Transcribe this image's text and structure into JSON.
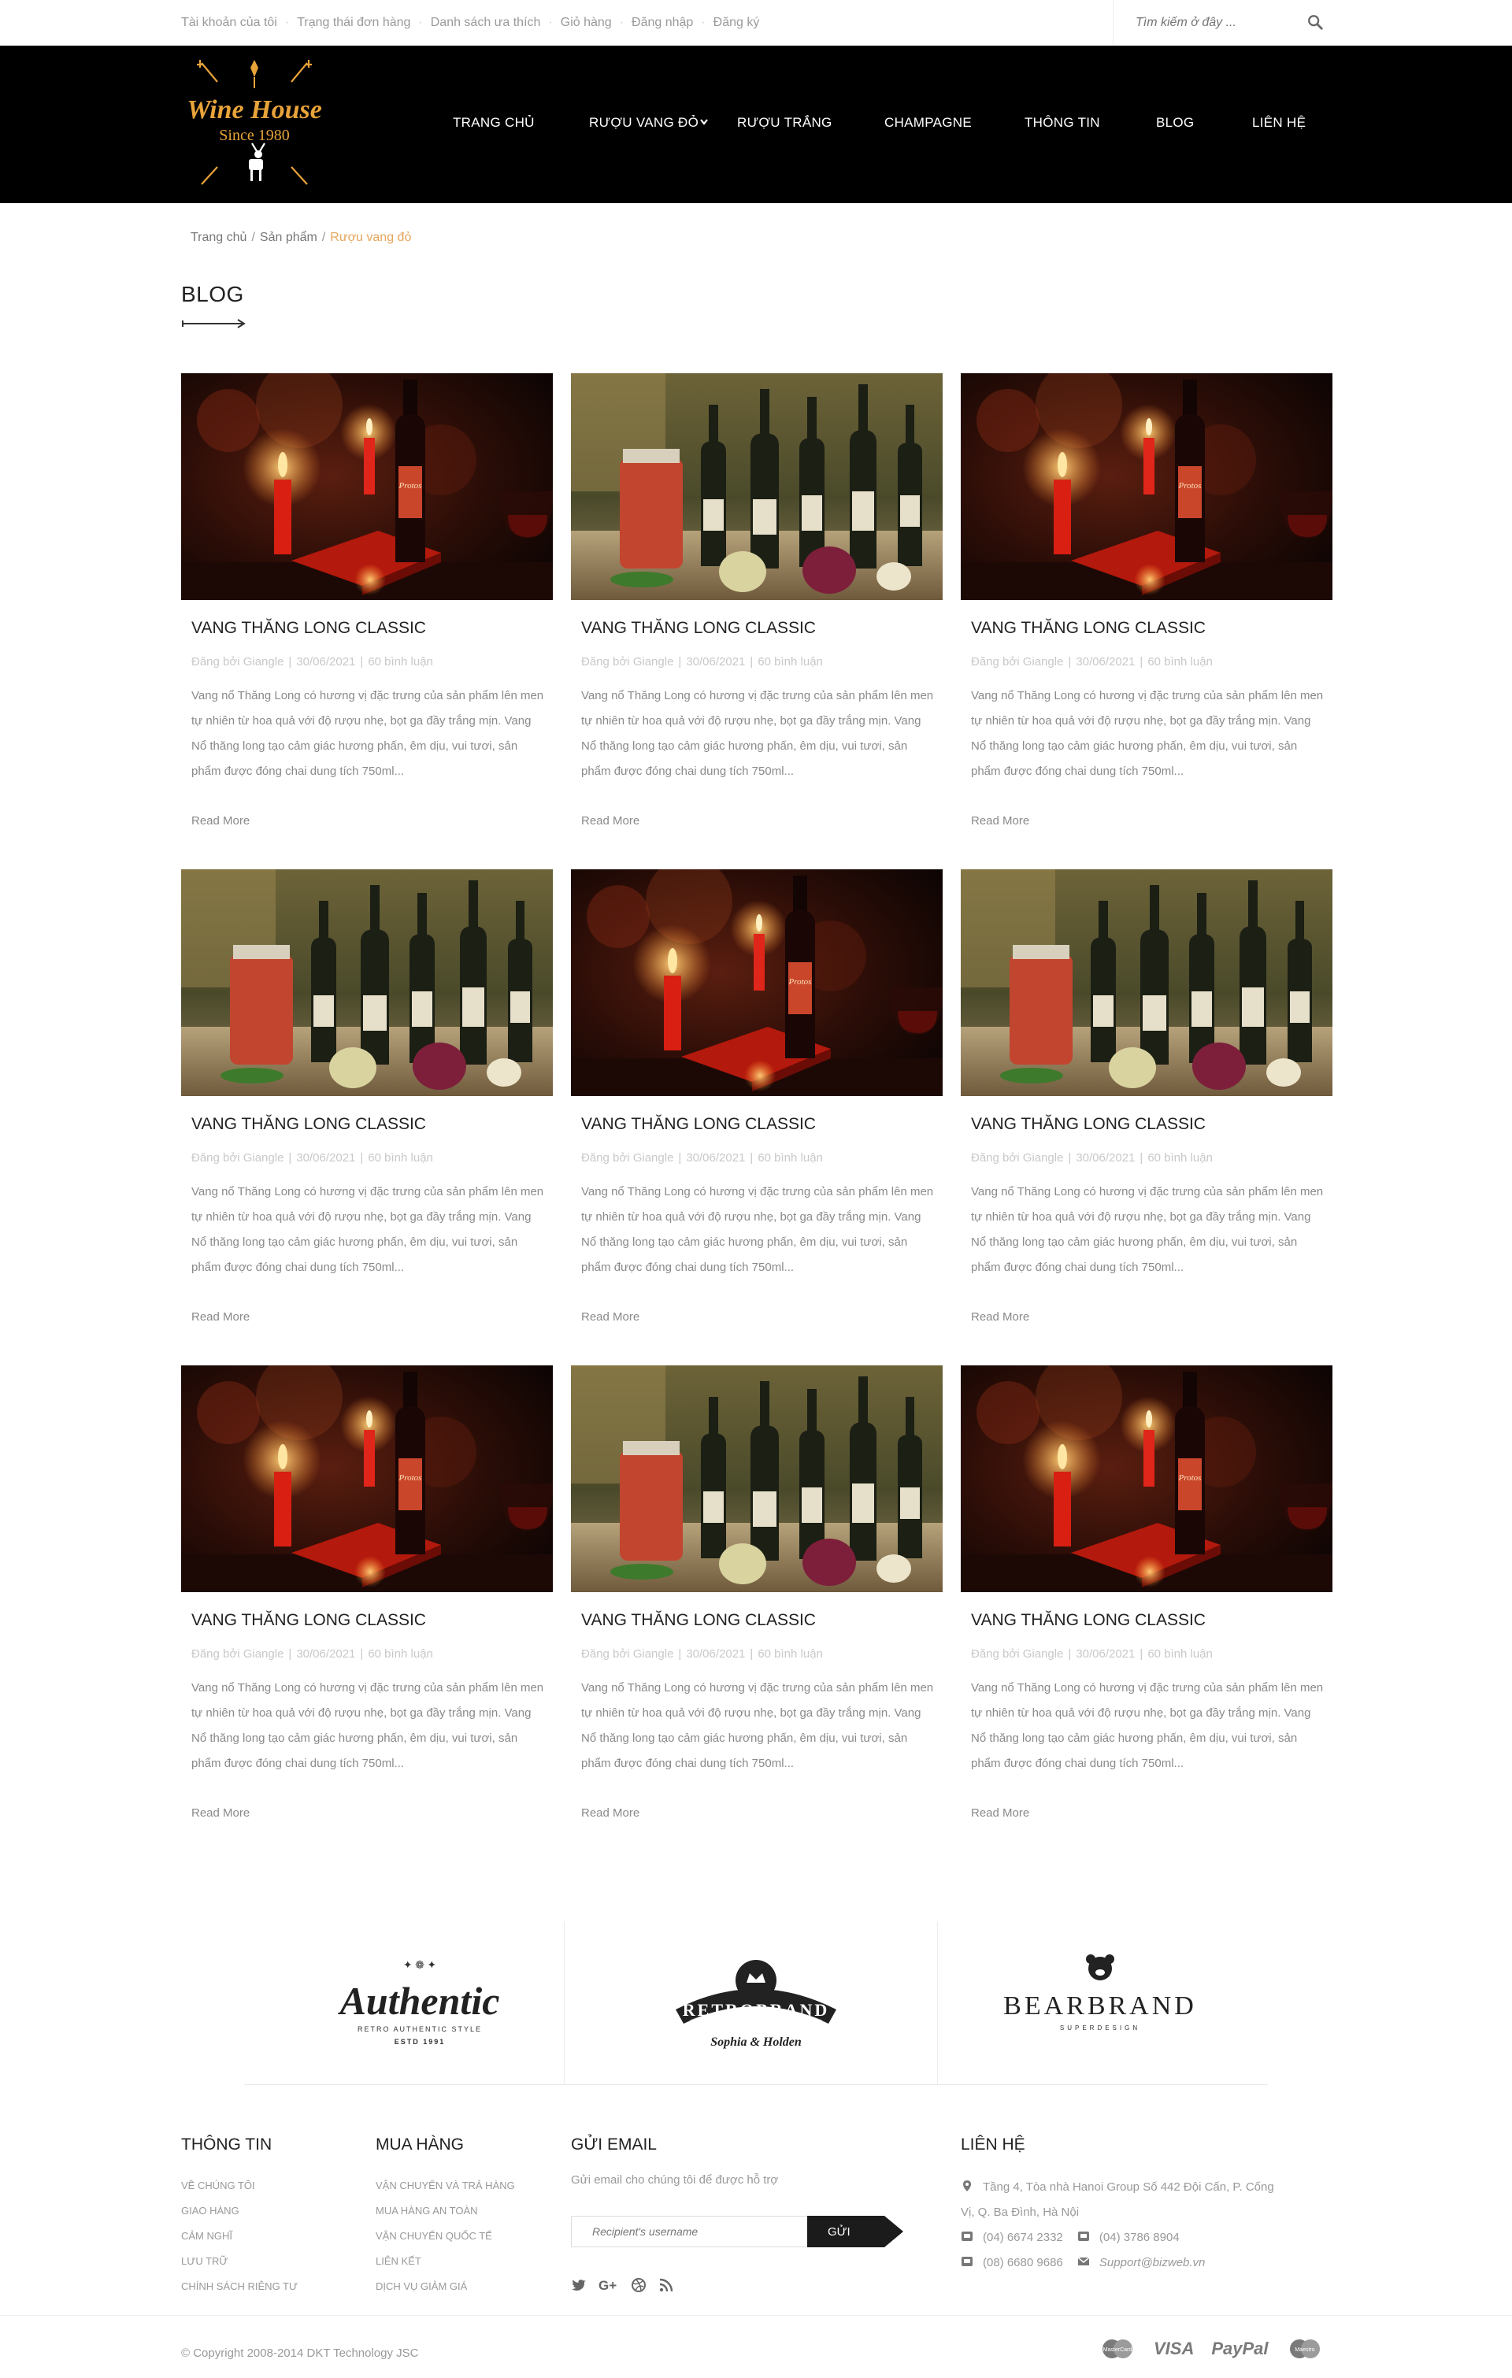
{
  "topbar": {
    "links": [
      "Tài khoản của tôi",
      "Trạng thái đơn hàng",
      "Danh sách ưa thích",
      "Giỏ hàng",
      "Đăng nhập",
      "Đăng ký"
    ],
    "search_placeholder": "Tìm kiếm ở đây ..."
  },
  "logo": {
    "name": "Wine House",
    "tagline": "Since 1980"
  },
  "nav": {
    "items": [
      "TRANG CHỦ",
      "RƯỢU VANG ĐỎ",
      "RƯỢU TRẮNG",
      "CHAMPAGNE",
      "THÔNG TIN",
      "BLOG",
      "LIÊN HỆ"
    ]
  },
  "breadcrumb": {
    "home": "Trang chủ",
    "products": "Sản phẩm",
    "current": "Rượu vang đỏ"
  },
  "page_title": "BLOG",
  "posts": [
    {
      "title": "VANG THĂNG LONG CLASSIC",
      "author": "Đăng bởi Giangle",
      "date": "30/06/2021",
      "comments": "60 bình luận",
      "excerpt": "Vang nổ Thăng Long có hương vị đặc trưng của sản phẩm lên men tự nhiên từ hoa quả với độ rượu nhẹ, bọt ga đầy trắng mịn. Vang Nổ thăng long tạo cảm giác hương phấn, êm dịu, vui tươi, sản phẩm được đóng chai dung tích 750ml...",
      "read_more": "Read More",
      "image": "candle"
    },
    {
      "title": "VANG THĂNG LONG CLASSIC",
      "author": "Đăng bởi Giangle",
      "date": "30/06/2021",
      "comments": "60 bình luận",
      "excerpt": "Vang nổ Thăng Long có hương vị đặc trưng của sản phẩm lên men tự nhiên từ hoa quả với độ rượu nhẹ, bọt ga đầy trắng mịn. Vang Nổ thăng long tạo cảm giác hương phấn, êm dịu, vui tươi, sản phẩm được đóng chai dung tích 750ml...",
      "read_more": "Read More",
      "image": "bottles"
    },
    {
      "title": "VANG THĂNG LONG CLASSIC",
      "author": "Đăng bởi Giangle",
      "date": "30/06/2021",
      "comments": "60 bình luận",
      "excerpt": "Vang nổ Thăng Long có hương vị đặc trưng của sản phẩm lên men tự nhiên từ hoa quả với độ rượu nhẹ, bọt ga đầy trắng mịn. Vang Nổ thăng long tạo cảm giác hương phấn, êm dịu, vui tươi, sản phẩm được đóng chai dung tích 750ml...",
      "read_more": "Read More",
      "image": "candle"
    },
    {
      "title": "VANG THĂNG LONG CLASSIC",
      "author": "Đăng bởi Giangle",
      "date": "30/06/2021",
      "comments": "60 bình luận",
      "excerpt": "Vang nổ Thăng Long có hương vị đặc trưng của sản phẩm lên men tự nhiên từ hoa quả với độ rượu nhẹ, bọt ga đầy trắng mịn. Vang Nổ thăng long tạo cảm giác hương phấn, êm dịu, vui tươi, sản phẩm được đóng chai dung tích 750ml...",
      "read_more": "Read More",
      "image": "bottles"
    },
    {
      "title": "VANG THĂNG LONG CLASSIC",
      "author": "Đăng bởi Giangle",
      "date": "30/06/2021",
      "comments": "60 bình luận",
      "excerpt": "Vang nổ Thăng Long có hương vị đặc trưng của sản phẩm lên men tự nhiên từ hoa quả với độ rượu nhẹ, bọt ga đầy trắng mịn. Vang Nổ thăng long tạo cảm giác hương phấn, êm dịu, vui tươi, sản phẩm được đóng chai dung tích 750ml...",
      "read_more": "Read More",
      "image": "candle"
    },
    {
      "title": "VANG THĂNG LONG CLASSIC",
      "author": "Đăng bởi Giangle",
      "date": "30/06/2021",
      "comments": "60 bình luận",
      "excerpt": "Vang nổ Thăng Long có hương vị đặc trưng của sản phẩm lên men tự nhiên từ hoa quả với độ rượu nhẹ, bọt ga đầy trắng mịn. Vang Nổ thăng long tạo cảm giác hương phấn, êm dịu, vui tươi, sản phẩm được đóng chai dung tích 750ml...",
      "read_more": "Read More",
      "image": "bottles"
    },
    {
      "title": "VANG THĂNG LONG CLASSIC",
      "author": "Đăng bởi Giangle",
      "date": "30/06/2021",
      "comments": "60 bình luận",
      "excerpt": "Vang nổ Thăng Long có hương vị đặc trưng của sản phẩm lên men tự nhiên từ hoa quả với độ rượu nhẹ, bọt ga đầy trắng mịn. Vang Nổ thăng long tạo cảm giác hương phấn, êm dịu, vui tươi, sản phẩm được đóng chai dung tích 750ml...",
      "read_more": "Read More",
      "image": "candle"
    },
    {
      "title": "VANG THĂNG LONG CLASSIC",
      "author": "Đăng bởi Giangle",
      "date": "30/06/2021",
      "comments": "60 bình luận",
      "excerpt": "Vang nổ Thăng Long có hương vị đặc trưng của sản phẩm lên men tự nhiên từ hoa quả với độ rượu nhẹ, bọt ga đầy trắng mịn. Vang Nổ thăng long tạo cảm giác hương phấn, êm dịu, vui tươi, sản phẩm được đóng chai dung tích 750ml...",
      "read_more": "Read More",
      "image": "bottles"
    },
    {
      "title": "VANG THĂNG LONG CLASSIC",
      "author": "Đăng bởi Giangle",
      "date": "30/06/2021",
      "comments": "60 bình luận",
      "excerpt": "Vang nổ Thăng Long có hương vị đặc trưng của sản phẩm lên men tự nhiên từ hoa quả với độ rượu nhẹ, bọt ga đầy trắng mịn. Vang Nổ thăng long tạo cảm giác hương phấn, êm dịu, vui tươi, sản phẩm được đóng chai dung tích 750ml...",
      "read_more": "Read More",
      "image": "candle"
    }
  ],
  "brands": [
    {
      "name": "Authentic",
      "subtitle": "RETRO AUTHENTIC STYLE",
      "extra": "ESTD 1991"
    },
    {
      "name": "RETROBRAND",
      "subtitle": "Sophia & Holden",
      "extra": ""
    },
    {
      "name": "BEARBRAND",
      "subtitle": "SUPERDESIGN",
      "extra": ""
    }
  ],
  "footer": {
    "info": {
      "heading": "THÔNG TIN",
      "links": [
        "VỀ CHÚNG TÔI",
        "GIAO HÀNG",
        "CẢM NGHĨ",
        "LƯU TRỮ",
        "CHÍNH SÁCH RIÊNG TƯ"
      ]
    },
    "shop": {
      "heading": "MUA HÀNG",
      "links": [
        "VẬN CHUYỂN VÀ TRẢ HÀNG",
        "MUA HÀNG AN TOÀN",
        "VẬN CHUYỂN QUỐC TẾ",
        "LIÊN KẾT",
        "DỊCH VỤ GIẢM GIÁ"
      ]
    },
    "email": {
      "heading": "GỬI EMAIL",
      "text": "Gửi email cho chúng tôi để được hỗ trợ",
      "placeholder": "Recipient's username",
      "button": "GỬI"
    },
    "contact": {
      "heading": "LIÊN HỆ",
      "address_line1": "Tầng 4, Tòa nhà Hanoi Group Số 442 Đội Cấn, P. Cống",
      "address_line2": "Vị, Q. Ba Đình, Hà Nội",
      "phone1": "(04) 6674 2332",
      "phone2": "(04) 3786 8904",
      "phone3": "(08) 6680 9686",
      "email": "Support@bizweb.vn"
    },
    "copyright": "© Copyright 2008-2014 DKT Technology JSC",
    "payments": [
      "VISA",
      "PayPal"
    ]
  },
  "colors": {
    "accent": "#e6a55b",
    "header_bg": "#000000",
    "logo_gold": "#e8a33a"
  }
}
